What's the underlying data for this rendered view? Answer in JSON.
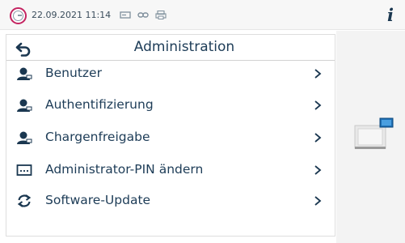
{
  "statusbar": {
    "datetime": "22.09.2021 11:14",
    "icons": [
      "lock-icon",
      "storage-icon",
      "network-icon",
      "printer-icon",
      "info-icon"
    ],
    "info_label": "i",
    "highlight_color": "#c42461"
  },
  "header": {
    "title": "Administration"
  },
  "menu": {
    "items": [
      {
        "label": "Benutzer",
        "icon": "user-icon"
      },
      {
        "label": "Authentifizierung",
        "icon": "user-icon"
      },
      {
        "label": "Chargenfreigabe",
        "icon": "user-icon"
      },
      {
        "label": "Administrator-PIN ändern",
        "icon": "pin-icon"
      },
      {
        "label": "Software-Update",
        "icon": "refresh-icon"
      }
    ]
  },
  "colors": {
    "text": "#1d3c57",
    "accent": "#1a3750"
  }
}
